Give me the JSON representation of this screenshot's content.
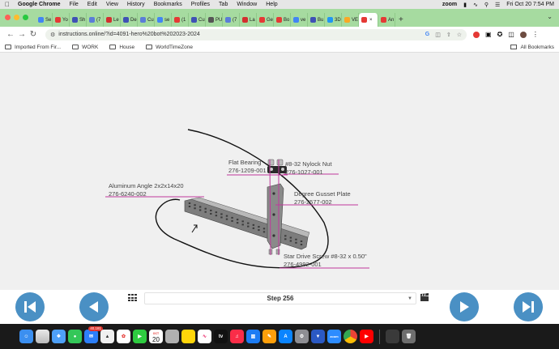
{
  "menubar": {
    "app_name": "Google Chrome",
    "items": [
      "File",
      "Edit",
      "View",
      "History",
      "Bookmarks",
      "Profiles",
      "Tab",
      "Window",
      "Help"
    ],
    "zoom_label": "zoom",
    "datetime": "Fri Oct 20  7:54 PM"
  },
  "tabs": [
    {
      "label": "Se",
      "color": "#4285f4"
    },
    {
      "label": "Yo",
      "color": "#e53935"
    },
    {
      "label": "Sh",
      "color": "#3f51b5"
    },
    {
      "label": "(7",
      "color": "#5b7dd8"
    },
    {
      "label": "Le",
      "color": "#d32f2f"
    },
    {
      "label": "De",
      "color": "#3f51b5"
    },
    {
      "label": "Cu",
      "color": "#5b7dd8"
    },
    {
      "label": "se",
      "color": "#4285f4"
    },
    {
      "label": "(1",
      "color": "#e53935"
    },
    {
      "label": "Cu",
      "color": "#3f51b5"
    },
    {
      "label": "PU",
      "color": "#555555"
    },
    {
      "label": "(7",
      "color": "#5b7dd8"
    },
    {
      "label": "La",
      "color": "#d32f2f"
    },
    {
      "label": "Ge",
      "color": "#e53935"
    },
    {
      "label": "Bo",
      "color": "#e53935"
    },
    {
      "label": "ve",
      "color": "#4285f4"
    },
    {
      "label": "Bu",
      "color": "#3f51b5"
    },
    {
      "label": "3D",
      "color": "#2196f3"
    },
    {
      "label": "VE",
      "color": "#f9a825"
    },
    {
      "label": "",
      "color": "#e53935",
      "active": true
    },
    {
      "label": "An",
      "color": "#e53935"
    }
  ],
  "toolbar": {
    "url": "instructions.online/?id=4091-hero%20bot%202023-2024"
  },
  "bookmarks": {
    "items": [
      "Imported From Fir...",
      "WORK",
      "House",
      "WorldTimeZone"
    ],
    "all_label": "All Bookmarks"
  },
  "callouts": {
    "flat_bearing": {
      "name": "Flat Bearing",
      "part": "276-1209-001"
    },
    "nylock_nut": {
      "name": "#8-32 Nylock Nut",
      "part": "276-1027-001"
    },
    "aluminum_angle": {
      "name": "Aluminum Angle 2x2x14x20",
      "part": "276-6240-002"
    },
    "gusset": {
      "name": "Degree Gusset Plate",
      "part": "276-2577-002"
    },
    "screw": {
      "name": "Star Drive Screw #8-32 x 0.50\"",
      "part": "276-4992-001"
    }
  },
  "controls": {
    "step_label": "Step 256",
    "accent": "#4a90c4"
  },
  "dock": {
    "mail_badge": "40,181",
    "calendar_day": "20",
    "calendar_month": "OCT",
    "tv_label": "tv",
    "zoom_label": "zoom"
  },
  "colors": {
    "tab_strip": "#a6dba0",
    "annotation": "#c0399c"
  }
}
